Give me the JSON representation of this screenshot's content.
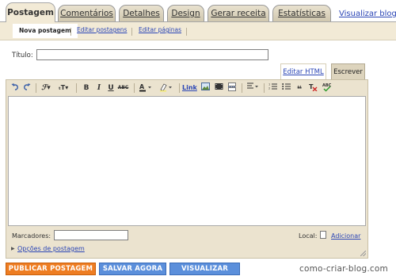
{
  "main_tabs": [
    {
      "label": "Postagem",
      "active": true
    },
    {
      "label": "Comentários",
      "active": false
    },
    {
      "label": "Detalhes",
      "active": false
    },
    {
      "label": "Design",
      "active": false
    },
    {
      "label": "Gerar receita",
      "active": false
    },
    {
      "label": "Estatísticas",
      "active": false
    }
  ],
  "view_blog_label": "Visualizar blog",
  "sub_tabs": [
    {
      "label": "Nova postagem",
      "active": true
    },
    {
      "label": "Editar postagens",
      "active": false
    },
    {
      "label": "Editar páginas",
      "active": false
    }
  ],
  "title_field": {
    "label": "Título:",
    "value": ""
  },
  "editor_modes": {
    "html_label": "Editar HTML",
    "compose_label": "Escrever"
  },
  "toolbar": {
    "undo_icon": "undo-icon",
    "redo_icon": "redo-icon",
    "font_icon": "font-family-icon",
    "font_size_icon": "font-size-icon",
    "bold_label": "B",
    "italic_label": "I",
    "underline_label": "U",
    "strike_label": "ABC",
    "text_color_icon": "text-color-icon",
    "highlight_icon": "highlight-icon",
    "link_label": "Link",
    "image_icon": "image-icon",
    "video_icon": "video-icon",
    "page_break_icon": "page-break-icon",
    "align_icon": "align-icon",
    "ordered_list_icon": "numbered-list-icon",
    "bullet_list_icon": "bulleted-list-icon",
    "quote_icon": "quote-icon",
    "clear_format_icon": "clear-formatting-icon",
    "spellcheck_label": "ABC"
  },
  "editor_body": "",
  "labels_field": {
    "label": "Marcadores:",
    "value": ""
  },
  "location": {
    "label": "Local:",
    "link": "Adicionar"
  },
  "post_options_label": "Opções de postagem",
  "buttons": {
    "publish": "PUBLICAR POSTAGEM",
    "save": "SALVAR AGORA",
    "preview": "VISUALIZAR"
  },
  "colors": {
    "publish": "#ee7d22",
    "secondary": "#5b8fdb",
    "tab_bg": "#f2ead6",
    "link": "#2b46b6"
  },
  "watermark": "como-criar-blog.com"
}
